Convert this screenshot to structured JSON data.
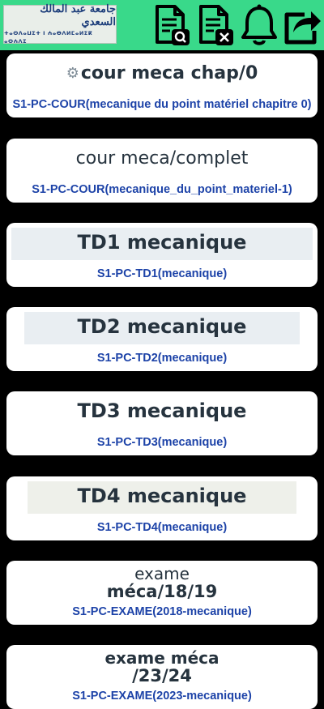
{
  "header": {
    "logo_arabic": "جامعة عبد المالك السعدي",
    "logo_tifinagh": "ⵜⴰⵙⴷⴰⵡⵉⵜ ⵏ ⵄⴰⴱⴷⵍⵎⴰⵍⵉⴽ ⴰⵙⵄⴷⵉ",
    "icons": [
      "document-search-icon",
      "document-delete-icon",
      "bell-icon",
      "share-icon"
    ],
    "color": "#39d98a"
  },
  "cards": [
    {
      "banner": "cour meca chap/0",
      "label": "S1-PC-COUR(mecanique du point matériel chapitre 0)"
    },
    {
      "banner": "cour meca/complet",
      "label": "S1-PC-COUR(mecanique_du_point_materiel-1)"
    },
    {
      "banner": "TD1 mecanique",
      "label": "S1-PC-TD1(mecanique)"
    },
    {
      "banner": "TD2 mecanique",
      "label": "S1-PC-TD2(mecanique)"
    },
    {
      "banner": "TD3 mecanique",
      "label": "S1-PC-TD3(mecanique)"
    },
    {
      "banner": "TD4 mecanique",
      "label": "S1-PC-TD4(mecanique)"
    },
    {
      "banner_line1": "exame",
      "banner_line2": "méca/18/19",
      "label": "S1-PC-EXAME(2018-mecanique)"
    },
    {
      "banner_line1": "exame méca",
      "banner_line2": "/23/24",
      "label": "S1-PC-EXAME(2023-mecanique)"
    }
  ],
  "colors": {
    "background": "#000000",
    "card": "#ffffff",
    "label": "#1d43a8",
    "banner_text": "#26333e"
  }
}
